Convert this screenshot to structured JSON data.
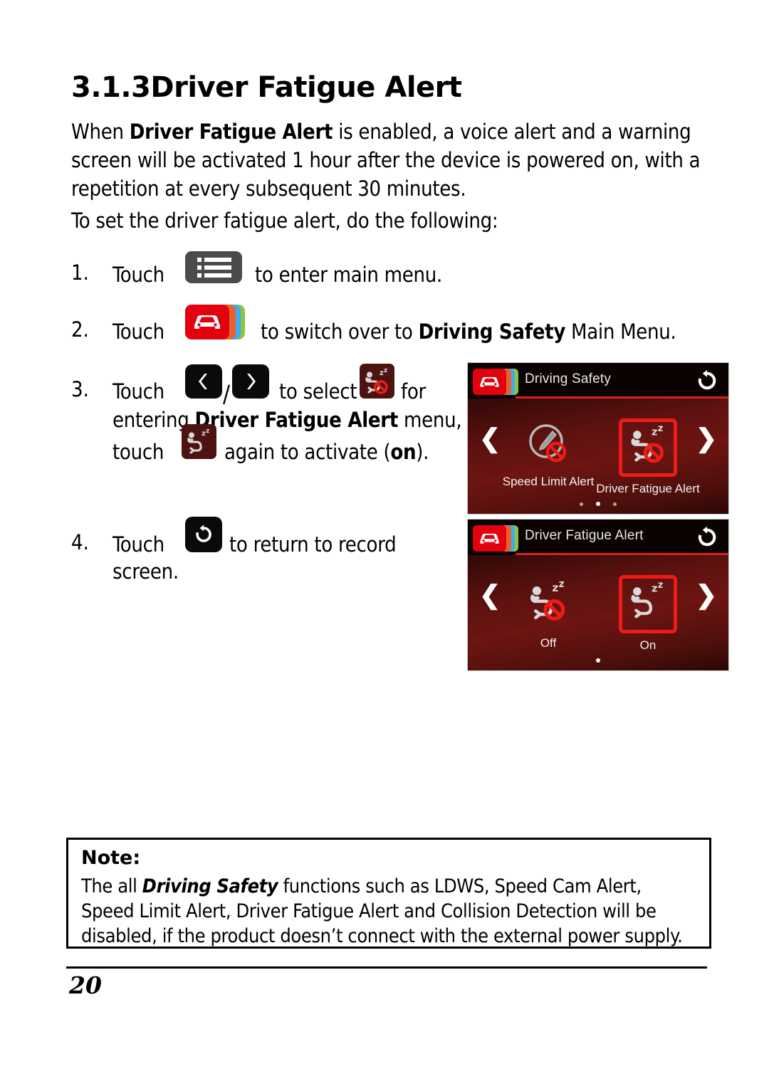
{
  "heading": {
    "number": "3.1.3",
    "title": "Driver Fatigue Alert"
  },
  "intro": {
    "before": "When ",
    "bold": "Driver Fatigue Alert",
    "after": " is enabled, a voice alert and a warning screen will be activated 1 hour after the device is powered on, with a repetition at every subsequent 30 minutes."
  },
  "lead": "To set the driver fatigue alert, do the following:",
  "steps": [
    {
      "number": "1.",
      "verb": "Touch",
      "icon": "main-menu-icon",
      "tail": "to enter main menu."
    },
    {
      "number": "2.",
      "verb": "Touch",
      "icon": "driving-safety-icon",
      "tail_before": "to switch over to ",
      "tail_bold": "Driving Safety",
      "tail_after": " Main Menu."
    },
    {
      "number": "3.",
      "verb": "Touch",
      "icon_left": "arrow-left-icon",
      "separator": "/",
      "icon_right": "arrow-right-icon",
      "mid": "to select",
      "icon_target": "driver-fatigue-off-icon",
      "after_target": "for",
      "line2_before": "entering ",
      "line2_bold": "Driver Fatigue Alert",
      "line2_after": " menu,",
      "line3_verb": "touch",
      "line3_icon": "driver-fatigue-on-icon",
      "line3_before": "again to activate (",
      "line3_bold": "on",
      "line3_after": ")."
    },
    {
      "number": "4.",
      "verb": "Touch",
      "icon": "return-icon",
      "tail_line1": "to return to record",
      "tail_line2": "screen."
    }
  ],
  "devices": [
    {
      "name": "driving-safety-screen",
      "title": "Driving Safety",
      "refresh_icon": "return-icon",
      "nav_left": "❮",
      "nav_right": "❯",
      "items": [
        {
          "label": "Speed Limit Alert",
          "icon": "speed-limit-alert-off-icon",
          "selected": false
        },
        {
          "label": "Driver Fatigue Alert",
          "icon": "driver-fatigue-off-icon",
          "selected": true
        }
      ],
      "pager": {
        "count": 3,
        "active": 1
      }
    },
    {
      "name": "driver-fatigue-alert-screen",
      "title": "Driver Fatigue Alert",
      "refresh_icon": "return-icon",
      "nav_left": "❮",
      "nav_right": "❯",
      "items": [
        {
          "label": "Off",
          "icon": "driver-fatigue-off-icon",
          "selected": false
        },
        {
          "label": "On",
          "icon": "driver-fatigue-on-icon",
          "selected": true
        }
      ],
      "pager": {
        "count": 1,
        "active": 0
      }
    }
  ],
  "note": {
    "title": "Note:",
    "before": "The all ",
    "bold": "Driving Safety",
    "after": " functions such as LDWS, Speed Cam Alert, Speed Limit Alert, Driver Fatigue Alert and Collision Detection will be disabled, if the product doesn’t connect with the external power supply."
  },
  "footer": {
    "page_number": "20"
  },
  "colors": {
    "brand_red": "#e3000f",
    "accent_orange": "#e8622a",
    "accent_blue": "#3fa9f5",
    "accent_green": "#8cc63e",
    "selection_red": "#ee1b16",
    "menu_gray": "#4b4b4b",
    "chip_dark": "#0a0a0a",
    "fatigue_chip_bg": "#4d1311"
  }
}
